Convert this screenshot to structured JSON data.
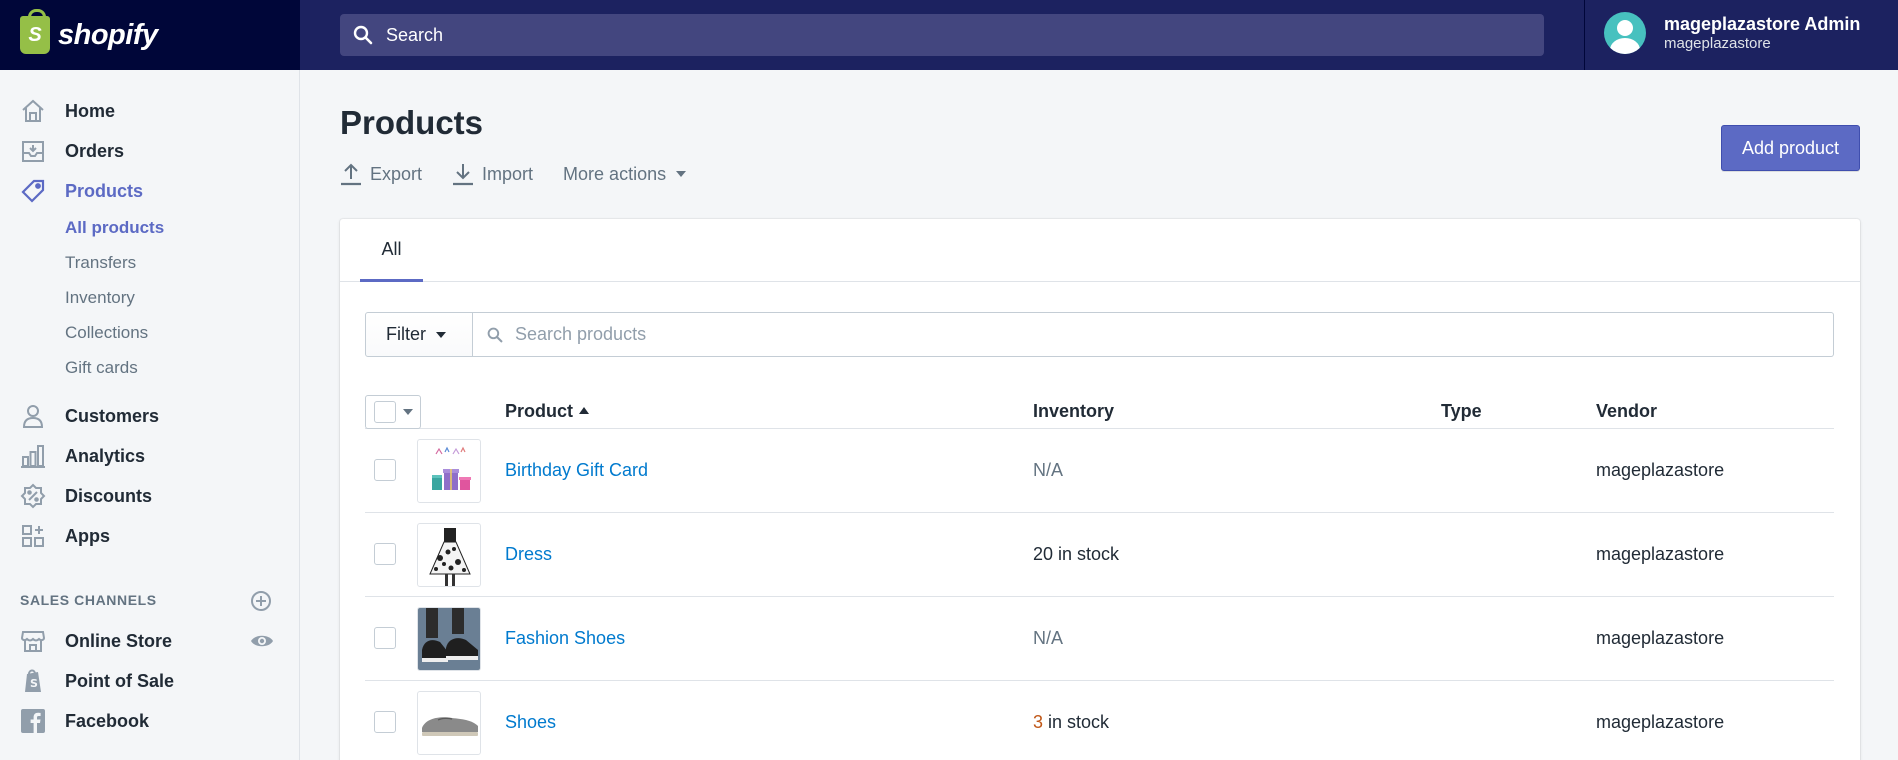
{
  "brand": {
    "name": "shopify",
    "bag_letter": "S"
  },
  "topbar": {
    "search_placeholder": "Search",
    "user_name": "mageplazastore Admin",
    "user_store": "mageplazastore"
  },
  "sidebar": {
    "nav": [
      {
        "label": "Home",
        "icon": "home-icon"
      },
      {
        "label": "Orders",
        "icon": "orders-icon"
      },
      {
        "label": "Products",
        "icon": "tag-icon",
        "active": true
      },
      {
        "label": "Customers",
        "icon": "person-icon"
      },
      {
        "label": "Analytics",
        "icon": "bar-chart-icon"
      },
      {
        "label": "Discounts",
        "icon": "discount-icon"
      },
      {
        "label": "Apps",
        "icon": "apps-icon"
      }
    ],
    "product_sub": [
      "All products",
      "Transfers",
      "Inventory",
      "Collections",
      "Gift cards"
    ],
    "sales_channels_title": "SALES CHANNELS",
    "channels": [
      {
        "label": "Online Store",
        "icon": "store-icon"
      },
      {
        "label": "Point of Sale",
        "icon": "pos-icon"
      },
      {
        "label": "Facebook",
        "icon": "facebook-icon"
      }
    ]
  },
  "page": {
    "title": "Products",
    "export_label": "Export",
    "import_label": "Import",
    "more_actions_label": "More actions",
    "add_product_label": "Add product",
    "tab_all": "All",
    "filter_label": "Filter",
    "search_products_placeholder": "Search products"
  },
  "table": {
    "headers": {
      "product": "Product",
      "inventory": "Inventory",
      "type": "Type",
      "vendor": "Vendor"
    },
    "rows": [
      {
        "name": "Birthday Gift Card",
        "inventory": "N/A",
        "type": "",
        "vendor": "mageplazastore"
      },
      {
        "name": "Dress",
        "inventory": "20 in stock",
        "type": "",
        "vendor": "mageplazastore"
      },
      {
        "name": "Fashion Shoes",
        "inventory": "N/A",
        "type": "",
        "vendor": "mageplazastore"
      },
      {
        "name": "Shoes",
        "inventory_count": "3",
        "inventory_suffix": " in stock",
        "type": "",
        "vendor": "mageplazastore"
      }
    ]
  },
  "colors": {
    "accent": "#5c6ac4",
    "link": "#007ace",
    "topbar": "#1c2260",
    "low_stock": "#c05717"
  }
}
